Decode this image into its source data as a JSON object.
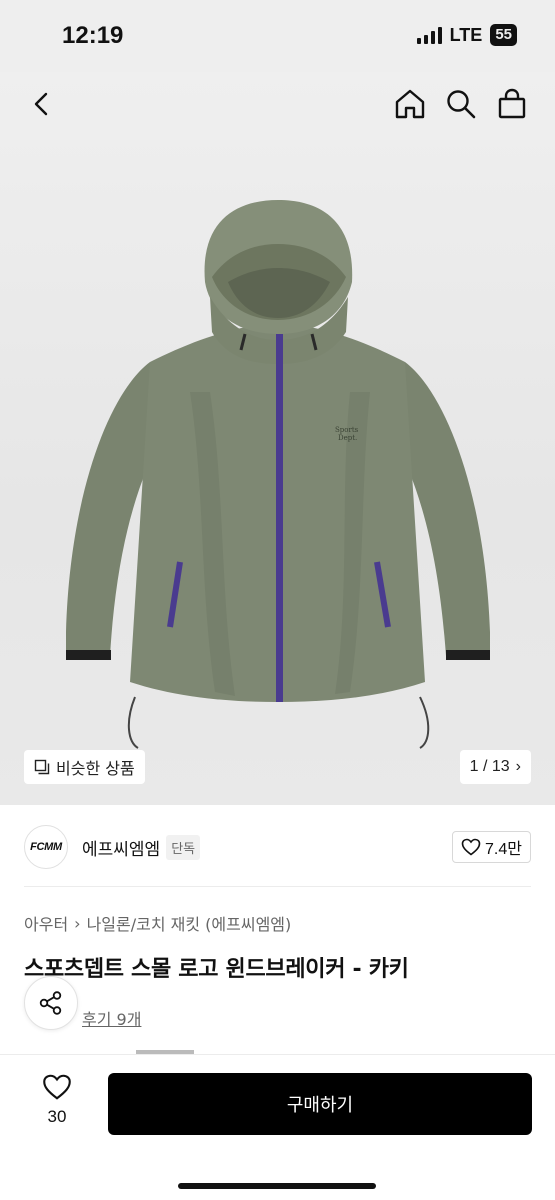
{
  "status_bar": {
    "time": "12:19",
    "network": "LTE",
    "battery": "55"
  },
  "header": {
    "back_icon": "chevron-left-icon",
    "home_icon": "home-icon",
    "search_icon": "search-icon",
    "cart_icon": "shopping-bag-icon"
  },
  "hero": {
    "similar_label": "비슷한 상품",
    "page_counter": "1 / 13",
    "jacket_colors": {
      "body": "#7b8571",
      "zip": "#4a3b8f"
    }
  },
  "brand": {
    "logo_text": "FCMM",
    "name": "에프씨엠엠",
    "tag": "단독",
    "likes": "7.4만"
  },
  "product": {
    "breadcrumb": [
      "아우터",
      "나일론/코치 재킷 (에프씨엠엠)"
    ],
    "title": "스포츠뎁트 스몰 로고 윈드브레이커 - 카키",
    "reviews": "후기 9개"
  },
  "bottom_bar": {
    "wish_count": "30",
    "buy_label": "구매하기"
  }
}
